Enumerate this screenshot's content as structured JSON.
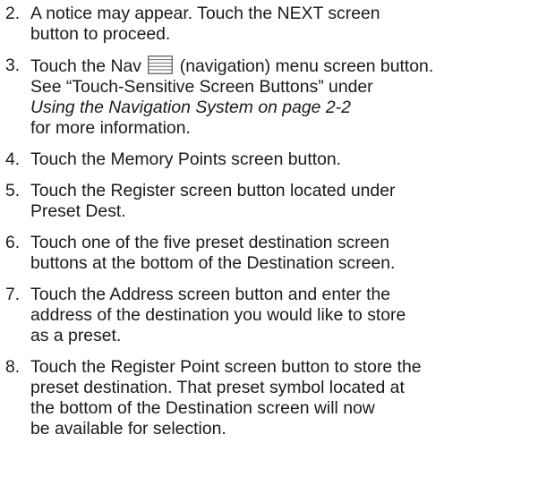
{
  "steps": [
    {
      "num": "2.",
      "lines": [
        "A notice may appear. Touch the NEXT screen",
        "button to proceed."
      ]
    },
    {
      "num": "3.",
      "line1_before_icon": "Touch the Nav",
      "icon": "nav-menu-icon",
      "line1_after_icon": "(navigation) menu screen button.",
      "line2": "See “Touch-Sensitive Screen Buttons” under",
      "line3_italic": "Using the Navigation System on page 2-2",
      "line4": "for more information."
    },
    {
      "num": "4.",
      "lines": [
        "Touch the Memory Points screen button."
      ]
    },
    {
      "num": "5.",
      "lines": [
        "Touch the Register screen button located under",
        "Preset Dest."
      ]
    },
    {
      "num": "6.",
      "lines": [
        "Touch one of the five preset destination screen",
        "buttons at the bottom of the Destination screen."
      ]
    },
    {
      "num": "7.",
      "lines": [
        "Touch the Address screen button and enter the",
        "address of the destination you would like to store",
        "as a preset."
      ]
    },
    {
      "num": "8.",
      "lines": [
        "Touch the Register Point screen button to store the",
        "preset destination. That preset symbol located at",
        "the bottom of the Destination screen will now",
        "be available for selection."
      ]
    }
  ]
}
